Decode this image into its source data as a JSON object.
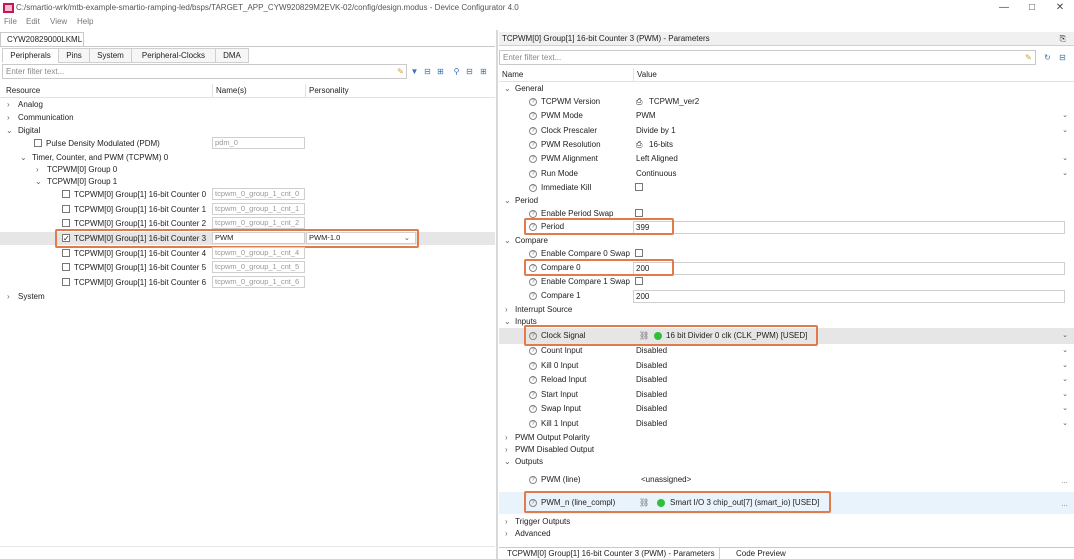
{
  "window": {
    "title": "C:/smartio-wrk/mtb-example-smartio-ramping-led/bsps/TARGET_APP_CYW920829M2EVK-02/config/design.modus - Device Configurator 4.0",
    "controls": [
      "—",
      "□",
      "✕"
    ]
  },
  "menu": [
    "File",
    "Edit",
    "View",
    "Help"
  ],
  "left": {
    "device_tab": "CYW20829000LKML",
    "tabs": [
      "Peripherals",
      "Pins",
      "System",
      "Peripheral-Clocks",
      "DMA"
    ],
    "active_tab": "Peripherals",
    "filter_placeholder": "Enter filter text...",
    "columns": [
      "Resource",
      "Name(s)",
      "Personality"
    ],
    "tree": {
      "analog": "Analog",
      "communication": "Communication",
      "digital": "Digital",
      "pdm": {
        "label": "Pulse Density Modulated (PDM)",
        "name": "pdm_0"
      },
      "tcpwm": "Timer, Counter, and PWM (TCPWM) 0",
      "group0": "TCPWM[0] Group 0",
      "group1": "TCPWM[0] Group 1",
      "counters": [
        {
          "label": "TCPWM[0] Group[1] 16-bit Counter 0",
          "name": "tcpwm_0_group_1_cnt_0",
          "checked": false
        },
        {
          "label": "TCPWM[0] Group[1] 16-bit Counter 1",
          "name": "tcpwm_0_group_1_cnt_1",
          "checked": false
        },
        {
          "label": "TCPWM[0] Group[1] 16-bit Counter 2",
          "name": "tcpwm_0_group_1_cnt_2",
          "checked": false
        },
        {
          "label": "TCPWM[0] Group[1] 16-bit Counter 3",
          "name": "PWM",
          "personality": "PWM-1.0",
          "checked": true
        },
        {
          "label": "TCPWM[0] Group[1] 16-bit Counter 4",
          "name": "tcpwm_0_group_1_cnt_4",
          "checked": false
        },
        {
          "label": "TCPWM[0] Group[1] 16-bit Counter 5",
          "name": "tcpwm_0_group_1_cnt_5",
          "checked": false
        },
        {
          "label": "TCPWM[0] Group[1] 16-bit Counter 6",
          "name": "tcpwm_0_group_1_cnt_6",
          "checked": false
        }
      ],
      "system": "System"
    }
  },
  "right": {
    "title": "TCPWM[0] Group[1] 16-bit Counter 3 (PWM) - Parameters",
    "filter_placeholder": "Enter filter text...",
    "columns": [
      "Name",
      "Value"
    ],
    "sections": {
      "general": "General",
      "period": "Period",
      "compare": "Compare",
      "interrupt": "Interrupt Source",
      "inputs": "Inputs",
      "pwm_out_polarity": "PWM Output Polarity",
      "pwm_disabled_output": "PWM Disabled Output",
      "outputs": "Outputs",
      "trigger_outputs": "Trigger Outputs",
      "advanced": "Advanced"
    },
    "params": {
      "tcpwm_version": {
        "label": "TCPWM Version",
        "value": "TCPWM_ver2"
      },
      "pwm_mode": {
        "label": "PWM Mode",
        "value": "PWM"
      },
      "clock_prescaler": {
        "label": "Clock Prescaler",
        "value": "Divide by 1"
      },
      "pwm_resolution": {
        "label": "PWM Resolution",
        "value": "16-bits"
      },
      "pwm_alignment": {
        "label": "PWM Alignment",
        "value": "Left Aligned"
      },
      "run_mode": {
        "label": "Run Mode",
        "value": "Continuous"
      },
      "immediate_kill": {
        "label": "Immediate Kill"
      },
      "enable_period_swap": {
        "label": "Enable Period Swap"
      },
      "period": {
        "label": "Period",
        "value": "399"
      },
      "enable_compare0_swap": {
        "label": "Enable Compare 0 Swap"
      },
      "compare0": {
        "label": "Compare 0",
        "value": "200"
      },
      "enable_compare1_swap": {
        "label": "Enable Compare 1 Swap"
      },
      "compare1": {
        "label": "Compare 1",
        "value": "200"
      },
      "clock_signal": {
        "label": "Clock Signal",
        "value": "16 bit Divider 0 clk (CLK_PWM) [USED]"
      },
      "count_input": {
        "label": "Count Input",
        "value": "Disabled"
      },
      "kill0_input": {
        "label": "Kill 0 Input",
        "value": "Disabled"
      },
      "reload_input": {
        "label": "Reload Input",
        "value": "Disabled"
      },
      "start_input": {
        "label": "Start Input",
        "value": "Disabled"
      },
      "swap_input": {
        "label": "Swap Input",
        "value": "Disabled"
      },
      "kill1_input": {
        "label": "Kill 1 Input",
        "value": "Disabled"
      },
      "pwm_line": {
        "label": "PWM (line)",
        "value": "<unassigned>"
      },
      "pwm_n_line": {
        "label": "PWM_n (line_compl)",
        "value": "Smart I/O 3 chip_out[7] (smart_io) [USED]"
      }
    },
    "bottom_tabs": [
      "TCPWM[0] Group[1] 16-bit Counter 3 (PWM) - Parameters",
      "Code Preview"
    ]
  },
  "colors": {
    "highlight": "#e07b4c",
    "used_dot": "#2fbf3a",
    "selection": "#e6e6e6"
  },
  "icons": [
    "app-icon",
    "clear-filter-icon",
    "filter-icon",
    "collapse-icon",
    "expand-icon",
    "link-icon",
    "help-icon",
    "dropdown-chevron-icon"
  ]
}
